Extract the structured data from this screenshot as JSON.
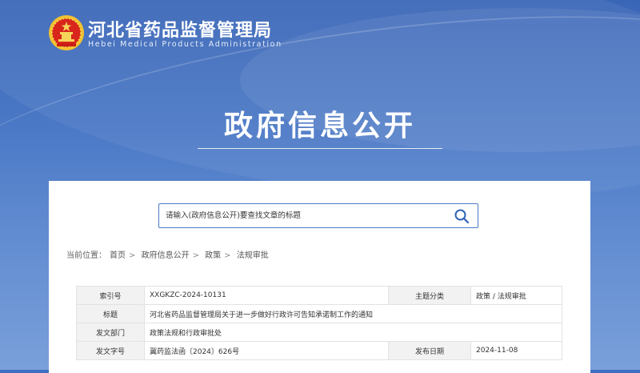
{
  "header": {
    "site_title": "河北省药品监督管理局",
    "site_subtitle": "Hebei Medical Products Administration",
    "section_title": "政府信息公开"
  },
  "search": {
    "placeholder": "请输入(政府信息公开)要查找文章的标题",
    "icon": "search-icon"
  },
  "breadcrumb": {
    "prefix": "当前位置：",
    "items": [
      "首页",
      "政府信息公开",
      "政策",
      "法规审批"
    ],
    "separator": ">"
  },
  "meta": {
    "index_label": "索引号",
    "index_value": "XXGKZC-2024-10131",
    "category_label": "主题分类",
    "category_value": "政策 / 法规审批",
    "title_label": "标题",
    "title_value": "河北省药品监督管理局关于进一步做好行政许可告知承诺制工作的通知",
    "dept_label": "发文部门",
    "dept_value": "政策法规和行政审批处",
    "docno_label": "发文字号",
    "docno_value": "冀药监法函〔2024〕626号",
    "date_label": "发布日期",
    "date_value": "2024-11-08"
  }
}
